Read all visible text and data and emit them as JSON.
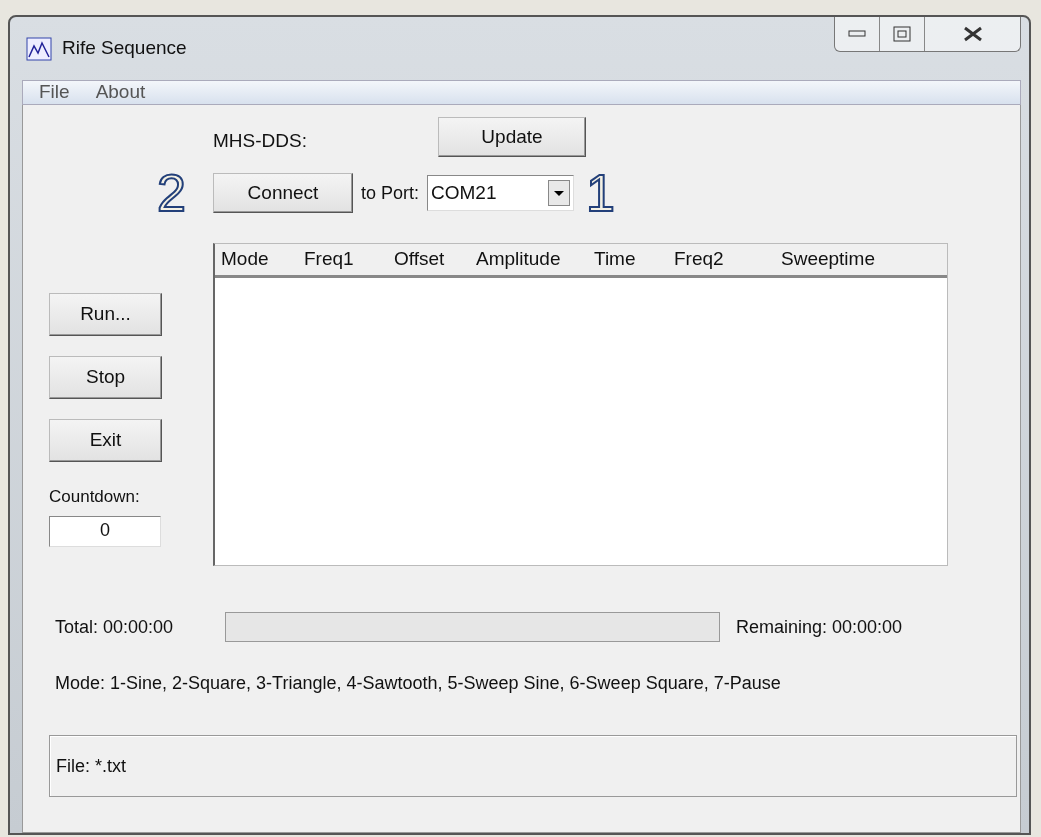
{
  "window": {
    "title": "Rife Sequence"
  },
  "menu": [
    {
      "label": "File"
    },
    {
      "label": "About"
    }
  ],
  "device": {
    "label": "MHS-DDS:",
    "update_button": "Update",
    "connect_button": "Connect",
    "port_label": "to Port:",
    "port_value": "COM21"
  },
  "callouts": [
    {
      "label": "2"
    },
    {
      "label": "1"
    }
  ],
  "list": {
    "columns": [
      "Mode",
      "Freq1",
      "Offset",
      "Amplitude",
      "Time",
      "Freq2",
      "Sweeptime"
    ]
  },
  "side_buttons": [
    "Run...",
    "Stop",
    "Exit"
  ],
  "countdown": {
    "label": "Countdown:",
    "value": "0"
  },
  "progress": {
    "total": "Total: 00:00:00",
    "level": 0,
    "remaining": "Remaining: 00:00:00"
  },
  "mode_legend": "Mode: 1-Sine, 2-Square, 3-Triangle, 4-Sawtooth, 5-Sweep Sine, 6-Sweep Square, 7-Pause",
  "status": {
    "file": "File: *.txt"
  }
}
